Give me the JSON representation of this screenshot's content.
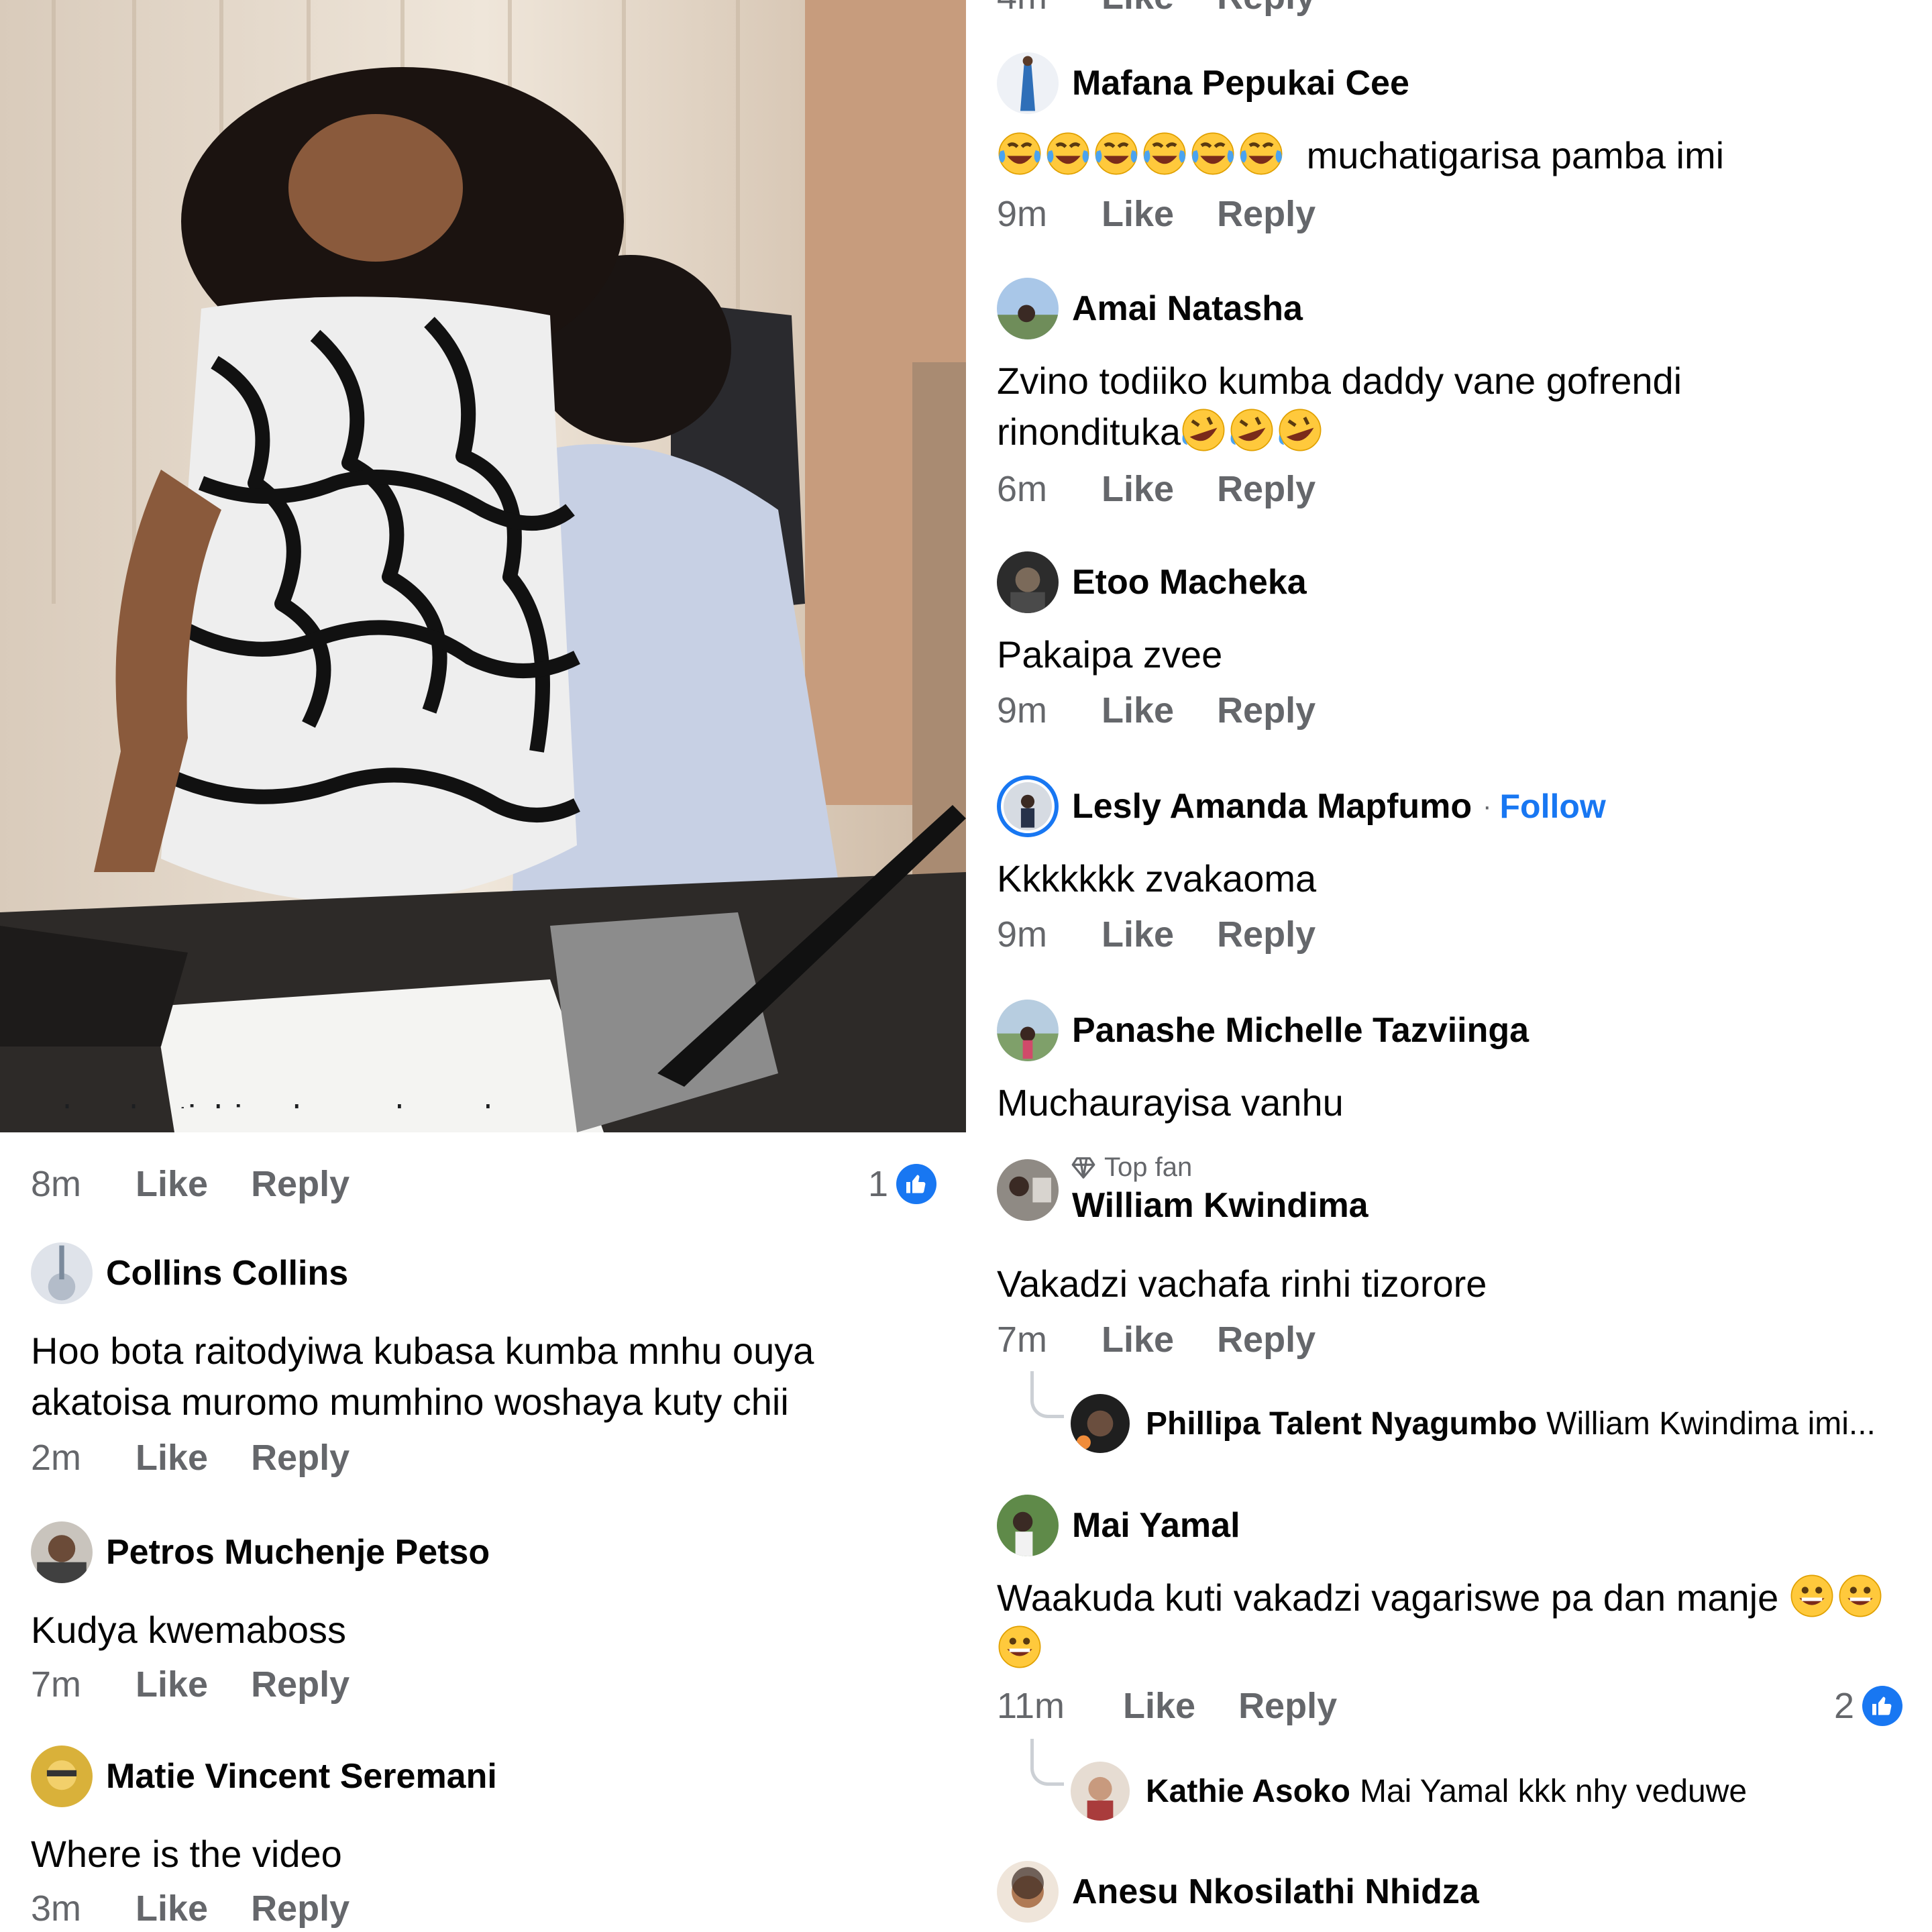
{
  "left_column": {
    "cut_text": "ndosaka tichizodyawo kumabasa",
    "first_meta": {
      "time": "8m",
      "like": "Like",
      "reply": "Reply",
      "reactions": "1"
    },
    "comments": [
      {
        "name": "Collins Collins",
        "lines": [
          "Hoo bota raitodyiwa kubasa kumba mnhu ouya",
          "akatoisa muromo mumhino woshaya kuty chii"
        ],
        "time": "2m",
        "like": "Like",
        "reply": "Reply"
      },
      {
        "name": "Petros Muchenje Petso",
        "lines": [
          "Kudya kwemaboss"
        ],
        "time": "7m",
        "like": "Like",
        "reply": "Reply"
      },
      {
        "name": "Matie Vincent Seremani",
        "lines": [
          "Where is the video"
        ],
        "time": "3m",
        "like": "Like",
        "reply": "Reply"
      }
    ]
  },
  "right_column": {
    "top_meta": {
      "time": "4m",
      "like": "Like",
      "reply": "Reply"
    },
    "comments": [
      {
        "name": "Mafana Pepukai Cee",
        "text": "muchatigarisa pamba imi",
        "time": "9m",
        "like": "Like",
        "reply": "Reply"
      },
      {
        "name": "Amai Natasha",
        "lines": [
          "Zvino todiiko kumba daddy vane gofrendi",
          "rinondituka"
        ],
        "time": "6m",
        "like": "Like",
        "reply": "Reply"
      },
      {
        "name": "Etoo Macheka",
        "lines": [
          "Pakaipa zvee"
        ],
        "time": "9m",
        "like": "Like",
        "reply": "Reply"
      },
      {
        "name": "Lesly Amanda Mapfumo",
        "separator": "·",
        "follow": "Follow",
        "lines": [
          "Kkkkkkk zvakaoma"
        ],
        "time": "9m",
        "like": "Like",
        "reply": "Reply"
      },
      {
        "name": "Panashe Michelle Tazviinga",
        "lines": [
          "Muchaurayisa vanhu"
        ]
      },
      {
        "badge": "Top fan",
        "name": "William Kwindima",
        "lines": [
          "Vakadzi vachafa rinhi tizorore"
        ],
        "time": "7m",
        "like": "Like",
        "reply": "Reply",
        "reply_item": {
          "name": "Phillipa Talent Nyagumbo",
          "text": "William Kwindima imi..."
        }
      },
      {
        "name": "Mai Yamal",
        "lines": [
          "Waakuda kuti vakadzi vagariswe pa dan manje"
        ],
        "time": "11m",
        "like": "Like",
        "reply": "Reply",
        "reactions": "2",
        "reply_item": {
          "name": "Kathie Asoko",
          "text": "Mai Yamal kkk nhy veduwe"
        }
      },
      {
        "name": "Anesu Nkosilathi Nhidza"
      }
    ]
  },
  "icons": {
    "like_badge": "thumbs-up-icon",
    "top_fan": "diamond-icon",
    "emoji_laugh": "tears-of-joy-emoji",
    "emoji_rofl": "rolling-laughing-emoji",
    "emoji_grin": "grinning-emoji"
  },
  "colors": {
    "accent": "#1877f2",
    "secondary_text": "#65676b",
    "primary_text": "#050505"
  }
}
